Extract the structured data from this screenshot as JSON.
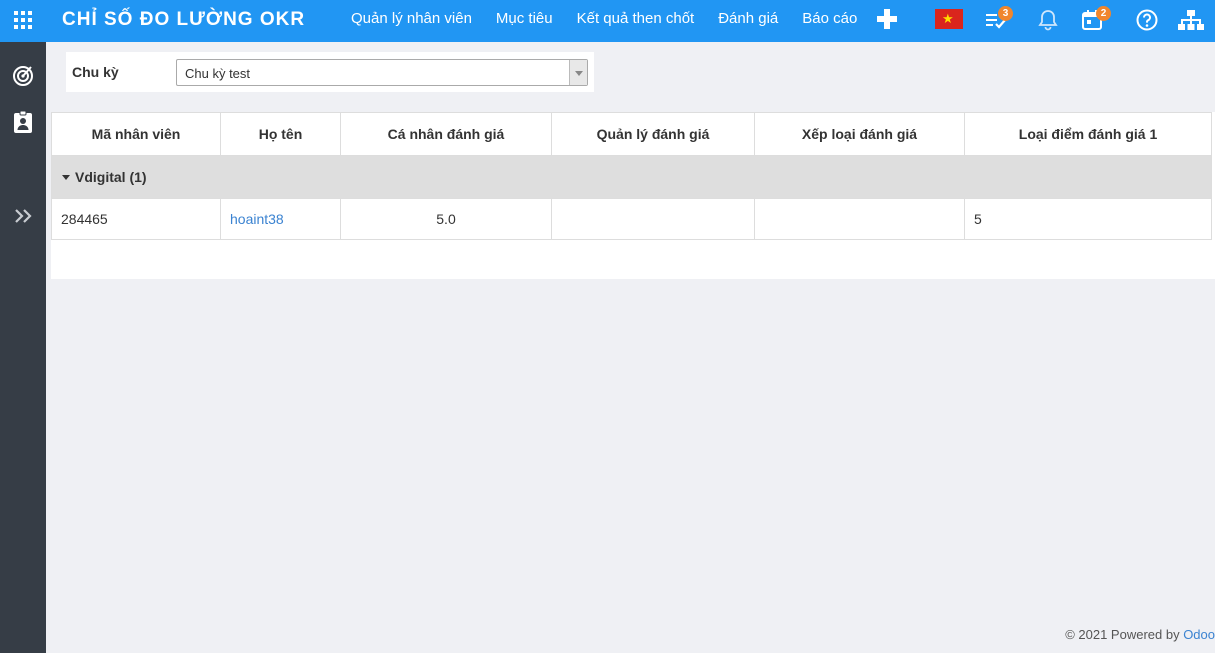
{
  "header": {
    "brand": "CHỈ SỐ ĐO LƯỜNG OKR",
    "menu": [
      "Quản lý nhân viên",
      "Mục tiêu",
      "Kết quả then chốt",
      "Đánh giá",
      "Báo cáo"
    ],
    "icons": [
      "apps-icon",
      "plus-icon",
      "vietnam-flag-icon",
      "checklist-icon",
      "bell-icon",
      "calendar-icon",
      "help-icon",
      "org-chart-icon"
    ],
    "activity_count": "3",
    "calendar_count": "2",
    "brand_color": "#2196f3",
    "badge_color": "#f0862d"
  },
  "sidebar": {
    "icons": [
      "target-icon",
      "clipboard-user-icon",
      "expand-chevrons-icon"
    ],
    "bg_color": "#363d46"
  },
  "filter": {
    "label": "Chu kỳ",
    "selected": "Chu kỳ test"
  },
  "table": {
    "columns": [
      "Mã nhân viên",
      "Họ tên",
      "Cá nhân đánh giá",
      "Quản lý đánh giá",
      "Xếp loại đánh giá",
      "Loại điểm đánh giá 1"
    ],
    "group": "Vdigital (1)",
    "rows": [
      [
        "284465",
        "hoaint38",
        "5.0",
        "",
        "",
        "5"
      ]
    ]
  },
  "footer": {
    "text": "© 2021 Powered by ",
    "link": "Odoo"
  }
}
